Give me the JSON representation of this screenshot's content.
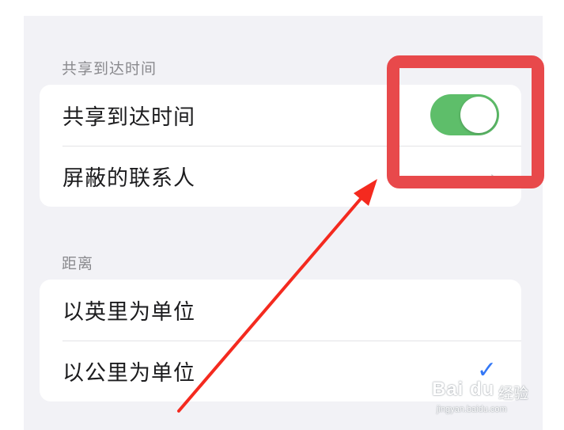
{
  "sections": [
    {
      "header": "共享到达时间",
      "rows": [
        {
          "label": "共享到达时间",
          "control": "toggle",
          "toggle_on": true
        },
        {
          "label": "屏蔽的联系人",
          "control": "chevron"
        }
      ]
    },
    {
      "header": "距离",
      "rows": [
        {
          "label": "以英里为单位",
          "control": "none"
        },
        {
          "label": "以公里为单位",
          "control": "checkmark",
          "checked": true
        }
      ]
    }
  ],
  "icons": {
    "chevron": "chevron-right-icon",
    "checkmark": "checkmark-icon"
  },
  "annotation": {
    "box_color": "#e8494b",
    "arrow_color": "#f42a1f"
  },
  "colors": {
    "toggle_on": "#5ebe6a",
    "checkmark": "#3478f6",
    "background": "#f2f2f6"
  },
  "watermark": {
    "brand": "Bai du",
    "suffix": "经验",
    "url": "jingyan.baidu.com"
  }
}
